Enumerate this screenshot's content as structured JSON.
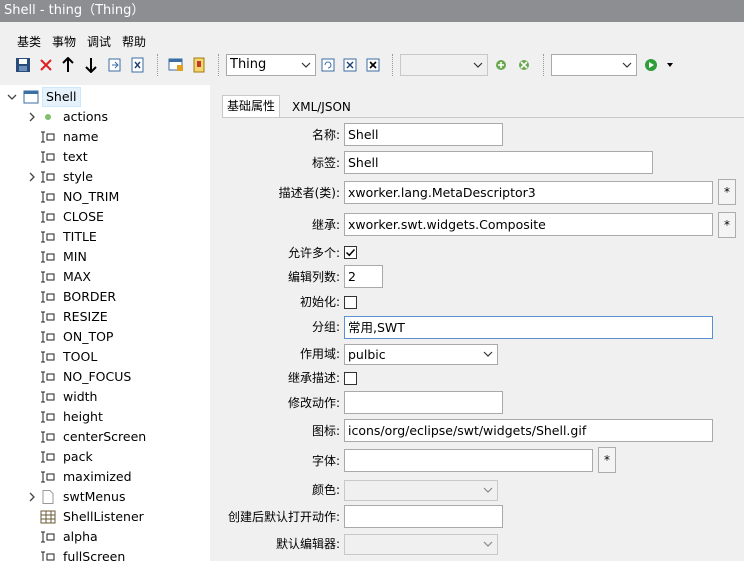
{
  "window": {
    "title": "Shell - thing（Thing）"
  },
  "menu": {
    "items": [
      "基类",
      "事物",
      "调试",
      "帮助"
    ]
  },
  "toolbar": {
    "thing_combo": "Thing",
    "second_combo": "",
    "third_combo": "",
    "icons": [
      "save-icon",
      "delete-icon",
      "move-up-icon",
      "move-down-icon",
      "open-icon",
      "xml-icon",
      "new-window-icon",
      "bookmark-icon",
      "refresh-icon",
      "close-x-icon",
      "close-all-icon",
      "add-thing-icon",
      "remove-thing-icon",
      "run-icon",
      "dropdown-icon"
    ]
  },
  "tree": {
    "root": "Shell",
    "nodes": [
      {
        "label": "actions",
        "expandable": true,
        "icon": "dot-icon"
      },
      {
        "label": "name",
        "icon": "attribute-icon"
      },
      {
        "label": "text",
        "icon": "attribute-icon"
      },
      {
        "label": "style",
        "expandable": true,
        "icon": "attribute-icon"
      },
      {
        "label": "NO_TRIM",
        "icon": "attribute-icon"
      },
      {
        "label": "CLOSE",
        "icon": "attribute-icon"
      },
      {
        "label": "TITLE",
        "icon": "attribute-icon"
      },
      {
        "label": "MIN",
        "icon": "attribute-icon"
      },
      {
        "label": "MAX",
        "icon": "attribute-icon"
      },
      {
        "label": "BORDER",
        "icon": "attribute-icon"
      },
      {
        "label": "RESIZE",
        "icon": "attribute-icon"
      },
      {
        "label": "ON_TOP",
        "icon": "attribute-icon"
      },
      {
        "label": "TOOL",
        "icon": "attribute-icon"
      },
      {
        "label": "NO_FOCUS",
        "icon": "attribute-icon"
      },
      {
        "label": "width",
        "icon": "attribute-icon"
      },
      {
        "label": "height",
        "icon": "attribute-icon"
      },
      {
        "label": "centerScreen",
        "icon": "attribute-icon"
      },
      {
        "label": "pack",
        "icon": "attribute-icon"
      },
      {
        "label": "maximized",
        "icon": "attribute-icon"
      },
      {
        "label": "swtMenus",
        "expandable": true,
        "icon": "page-icon"
      },
      {
        "label": "ShellListener",
        "icon": "table-icon"
      },
      {
        "label": "alpha",
        "icon": "attribute-icon"
      },
      {
        "label": "fullScreen",
        "icon": "attribute-icon"
      }
    ]
  },
  "tabs": [
    "基础属性",
    "XML/JSON"
  ],
  "form": {
    "name_label": "名称:",
    "name_value": "Shell",
    "tag_label": "标签:",
    "tag_value": "Shell",
    "descriptor_label": "描述者(类):",
    "descriptor_value": "xworker.lang.MetaDescriptor3",
    "extends_label": "继承:",
    "extends_value": "xworker.swt.widgets.Composite",
    "allow_many_label": "允许多个:",
    "allow_many_checked": true,
    "edit_cols_label": "编辑列数:",
    "edit_cols_value": "2",
    "init_label": "初始化:",
    "init_checked": false,
    "group_label": "分组:",
    "group_value": "常用,SWT",
    "scope_label": "作用域:",
    "scope_value": "pulbic",
    "inherit_desc_label": "继承描述:",
    "inherit_desc_checked": false,
    "modify_action_label": "修改动作:",
    "modify_action_value": "",
    "icon_label": "图标:",
    "icon_value": "icons/org/eclipse/swt/widgets/Shell.gif",
    "font_label": "字体:",
    "font_value": "",
    "color_label": "颜色:",
    "color_value": "",
    "open_action_label": "创建后默认打开动作:",
    "open_action_value": "",
    "editor_label": "默认编辑器:",
    "editor_value": "",
    "star": "*"
  }
}
